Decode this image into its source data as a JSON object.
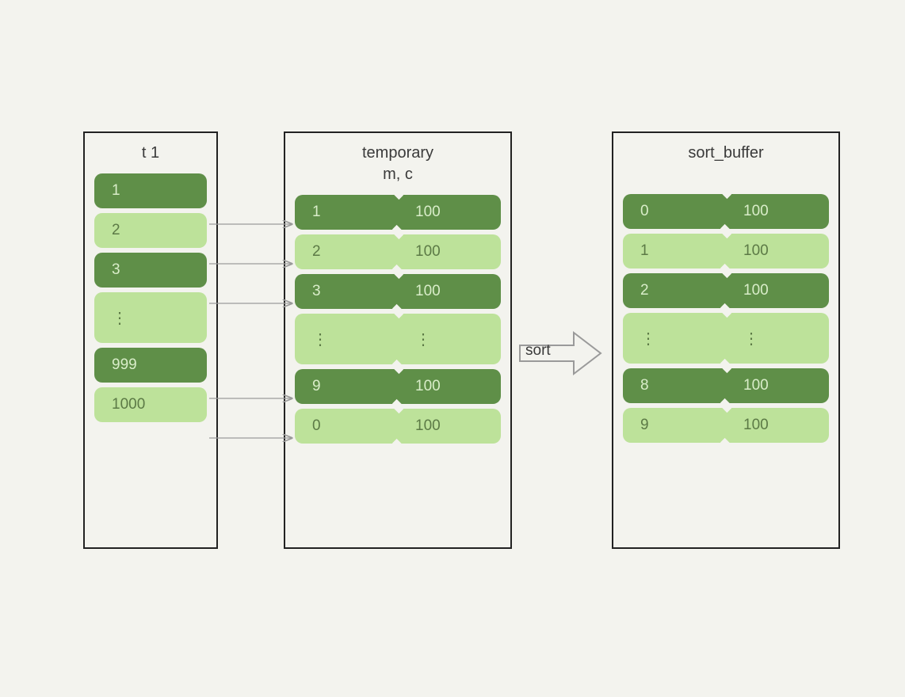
{
  "panels": {
    "t1": {
      "title": "t 1",
      "rows": [
        {
          "value": "1",
          "shade": "dark"
        },
        {
          "value": "2",
          "shade": "light"
        },
        {
          "value": "3",
          "shade": "dark"
        },
        {
          "value": "⋮",
          "shade": "light",
          "ellipsis": true
        },
        {
          "value": "999",
          "shade": "dark"
        },
        {
          "value": "1000",
          "shade": "light"
        }
      ]
    },
    "temporary": {
      "title": "temporary\nm, c",
      "rows": [
        {
          "left": "1",
          "right": "100",
          "shade": "dark"
        },
        {
          "left": "2",
          "right": "100",
          "shade": "light"
        },
        {
          "left": "3",
          "right": "100",
          "shade": "dark"
        },
        {
          "left": "⋮",
          "right": "⋮",
          "shade": "light",
          "ellipsis": true
        },
        {
          "left": "9",
          "right": "100",
          "shade": "dark"
        },
        {
          "left": "0",
          "right": "100",
          "shade": "light"
        }
      ]
    },
    "sort_buffer": {
      "title": "sort_buffer",
      "rows": [
        {
          "left": "0",
          "right": "100",
          "shade": "dark"
        },
        {
          "left": "1",
          "right": "100",
          "shade": "light"
        },
        {
          "left": "2",
          "right": "100",
          "shade": "dark"
        },
        {
          "left": "⋮",
          "right": "⋮",
          "shade": "light",
          "ellipsis": true
        },
        {
          "left": "8",
          "right": "100",
          "shade": "dark"
        },
        {
          "left": "9",
          "right": "100",
          "shade": "light"
        }
      ]
    }
  },
  "sort_label": "sort",
  "ellipsis_glyph": "⋮",
  "colors": {
    "background": "#f3f3ee",
    "cell_dark": "#5f8f48",
    "cell_light": "#bde29a",
    "border": "#222222",
    "arrow": "#9a9a9a"
  }
}
